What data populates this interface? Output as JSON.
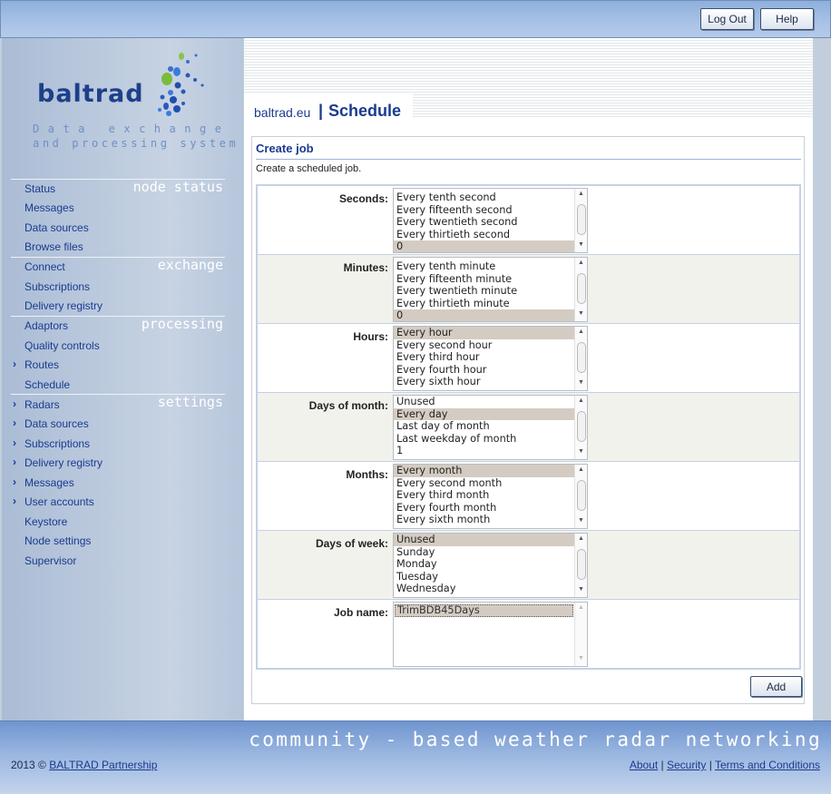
{
  "header": {
    "logout_label": "Log Out",
    "help_label": "Help"
  },
  "logo": {
    "wordmark": "baltrad",
    "tagline1": "Data exchange",
    "tagline2": "and processing system"
  },
  "sidebar": {
    "sections": {
      "node_status": "node status",
      "exchange": "exchange",
      "processing": "processing",
      "settings": "settings"
    },
    "items": [
      {
        "label": "Status",
        "expandable": false
      },
      {
        "label": "Messages",
        "expandable": false
      },
      {
        "label": "Data sources",
        "expandable": false
      },
      {
        "label": "Browse files",
        "expandable": false
      },
      {
        "label": "Connect",
        "expandable": false
      },
      {
        "label": "Subscriptions",
        "expandable": false
      },
      {
        "label": "Delivery registry",
        "expandable": false
      },
      {
        "label": "Adaptors",
        "expandable": false
      },
      {
        "label": "Quality controls",
        "expandable": false
      },
      {
        "label": "Routes",
        "expandable": true
      },
      {
        "label": "Schedule",
        "expandable": false
      },
      {
        "label": "Radars",
        "expandable": true
      },
      {
        "label": "Data sources",
        "expandable": true
      },
      {
        "label": "Subscriptions",
        "expandable": true
      },
      {
        "label": "Delivery registry",
        "expandable": true
      },
      {
        "label": "Messages",
        "expandable": true
      },
      {
        "label": "User accounts",
        "expandable": true
      },
      {
        "label": "Keystore",
        "expandable": false
      },
      {
        "label": "Node settings",
        "expandable": false
      },
      {
        "label": "Supervisor",
        "expandable": false
      }
    ],
    "chevron": "›"
  },
  "breadcrumb": {
    "site": "baltrad.eu",
    "separator": "|",
    "page": "Schedule"
  },
  "panel": {
    "title": "Create job",
    "description": "Create a scheduled job.",
    "add_label": "Add"
  },
  "form": {
    "rows": [
      {
        "label": "Seconds:",
        "options": [
          "Every tenth second",
          "Every fifteenth second",
          "Every twentieth second",
          "Every thirtieth second",
          "0"
        ],
        "selected": 4
      },
      {
        "label": "Minutes:",
        "options": [
          "Every tenth minute",
          "Every fifteenth minute",
          "Every twentieth minute",
          "Every thirtieth minute",
          "0"
        ],
        "selected": 4
      },
      {
        "label": "Hours:",
        "options": [
          "Every hour",
          "Every second hour",
          "Every third hour",
          "Every fourth hour",
          "Every sixth hour"
        ],
        "selected": 0
      },
      {
        "label": "Days of month:",
        "options": [
          "Unused",
          "Every day",
          "Last day of month",
          "Last weekday of month",
          "1"
        ],
        "selected": 1
      },
      {
        "label": "Months:",
        "options": [
          "Every month",
          "Every second month",
          "Every third month",
          "Every fourth month",
          "Every sixth month"
        ],
        "selected": 0
      },
      {
        "label": "Days of week:",
        "options": [
          "Unused",
          "Sunday",
          "Monday",
          "Tuesday",
          "Wednesday"
        ],
        "selected": 0
      }
    ],
    "job_name": {
      "label": "Job name:",
      "value": "TrimBDB45Days"
    }
  },
  "footer": {
    "slogan": "community - based weather radar networking",
    "copyright_prefix": "2013 © ",
    "copyright_link": "BALTRAD Partnership",
    "links": [
      "About",
      "Security",
      "Terms and Conditions"
    ],
    "link_separator": "|"
  },
  "colors": {
    "accent": "#1a3b8f",
    "selected_option": "#d4ccc2",
    "header": "#a8c2e6"
  }
}
